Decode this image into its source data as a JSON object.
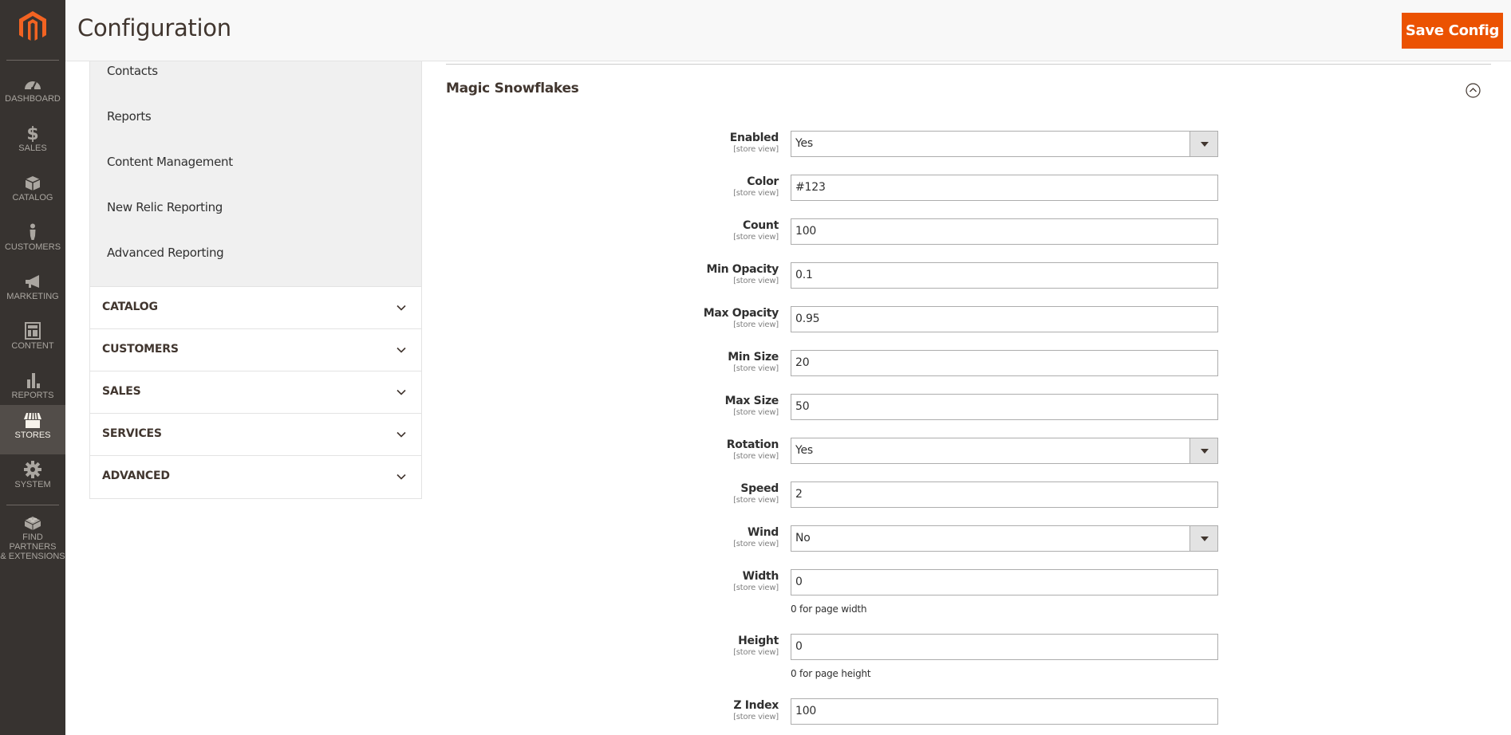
{
  "admin_nav": {
    "items": [
      {
        "label": "DASHBOARD",
        "icon": "dashboard-gauge-icon",
        "active": false
      },
      {
        "label": "SALES",
        "icon": "dollar-icon",
        "active": false
      },
      {
        "label": "CATALOG",
        "icon": "box-icon",
        "active": false
      },
      {
        "label": "CUSTOMERS",
        "icon": "person-icon",
        "active": false
      },
      {
        "label": "MARKETING",
        "icon": "megaphone-icon",
        "active": false
      },
      {
        "label": "CONTENT",
        "icon": "layout-icon",
        "active": false
      },
      {
        "label": "REPORTS",
        "icon": "bar-chart-icon",
        "active": false
      },
      {
        "label": "STORES",
        "icon": "storefront-icon",
        "active": true
      },
      {
        "label": "SYSTEM",
        "icon": "gear-icon",
        "active": false
      },
      {
        "label": "FIND PARTNERS",
        "label2": "& EXTENSIONS",
        "icon": "lego-brick-icon",
        "active": false
      }
    ]
  },
  "header": {
    "title": "Configuration",
    "save_label": "Save Config"
  },
  "config_nav": {
    "sub_items": [
      "Contacts",
      "Reports",
      "Content Management",
      "New Relic Reporting",
      "Advanced Reporting"
    ],
    "sections": [
      "CATALOG",
      "CUSTOMERS",
      "SALES",
      "SERVICES",
      "ADVANCED"
    ]
  },
  "fieldset": {
    "title": "Magic Snowflakes",
    "expanded": true,
    "fields": [
      {
        "label": "Enabled",
        "scope": "[store view]",
        "type": "select",
        "value": "Yes"
      },
      {
        "label": "Color",
        "scope": "[store view]",
        "type": "text",
        "value": "#123"
      },
      {
        "label": "Count",
        "scope": "[store view]",
        "type": "text",
        "value": "100"
      },
      {
        "label": "Min Opacity",
        "scope": "[store view]",
        "type": "text",
        "value": "0.1"
      },
      {
        "label": "Max Opacity",
        "scope": "[store view]",
        "type": "text",
        "value": "0.95"
      },
      {
        "label": "Min Size",
        "scope": "[store view]",
        "type": "text",
        "value": "20"
      },
      {
        "label": "Max Size",
        "scope": "[store view]",
        "type": "text",
        "value": "50"
      },
      {
        "label": "Rotation",
        "scope": "[store view]",
        "type": "select",
        "value": "Yes"
      },
      {
        "label": "Speed",
        "scope": "[store view]",
        "type": "text",
        "value": "2"
      },
      {
        "label": "Wind",
        "scope": "[store view]",
        "type": "select",
        "value": "No"
      },
      {
        "label": "Width",
        "scope": "[store view]",
        "type": "text",
        "value": "0",
        "note": "0 for page width"
      },
      {
        "label": "Height",
        "scope": "[store view]",
        "type": "text",
        "value": "0",
        "note": "0 for page height"
      },
      {
        "label": "Z Index",
        "scope": "[store view]",
        "type": "text",
        "value": "100"
      }
    ]
  },
  "colors": {
    "brand_orange": "#eb5202",
    "nav_bg": "#373330",
    "nav_active_bg": "#524d49"
  }
}
